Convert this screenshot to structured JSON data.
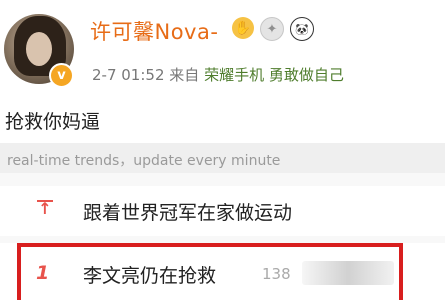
{
  "post": {
    "username": "许可馨Nova-",
    "verified_mark": "v",
    "badges": [
      {
        "icon": "hand-badge-icon",
        "glyph": "✋"
      },
      {
        "icon": "star-badge-icon",
        "glyph": "✦"
      },
      {
        "icon": "panda-badge-icon",
        "glyph": "🐼"
      }
    ],
    "time": "2-7 01:52",
    "from_label": "来自",
    "source": "荣耀手机 勇敢做自己",
    "text": "抢救你妈逼"
  },
  "trends": {
    "header": "real-time trends，update every minute",
    "items": [
      {
        "rank": "",
        "pinned": true,
        "title": "跟着世界冠军在家做运动",
        "count": ""
      },
      {
        "rank": "1",
        "pinned": false,
        "title": "李文亮仍在抢救",
        "count": "138"
      }
    ]
  },
  "colors": {
    "username": "#e76c17",
    "source": "#4f7d2d",
    "rank": "#e8534c",
    "highlight": "#d81e1e"
  }
}
